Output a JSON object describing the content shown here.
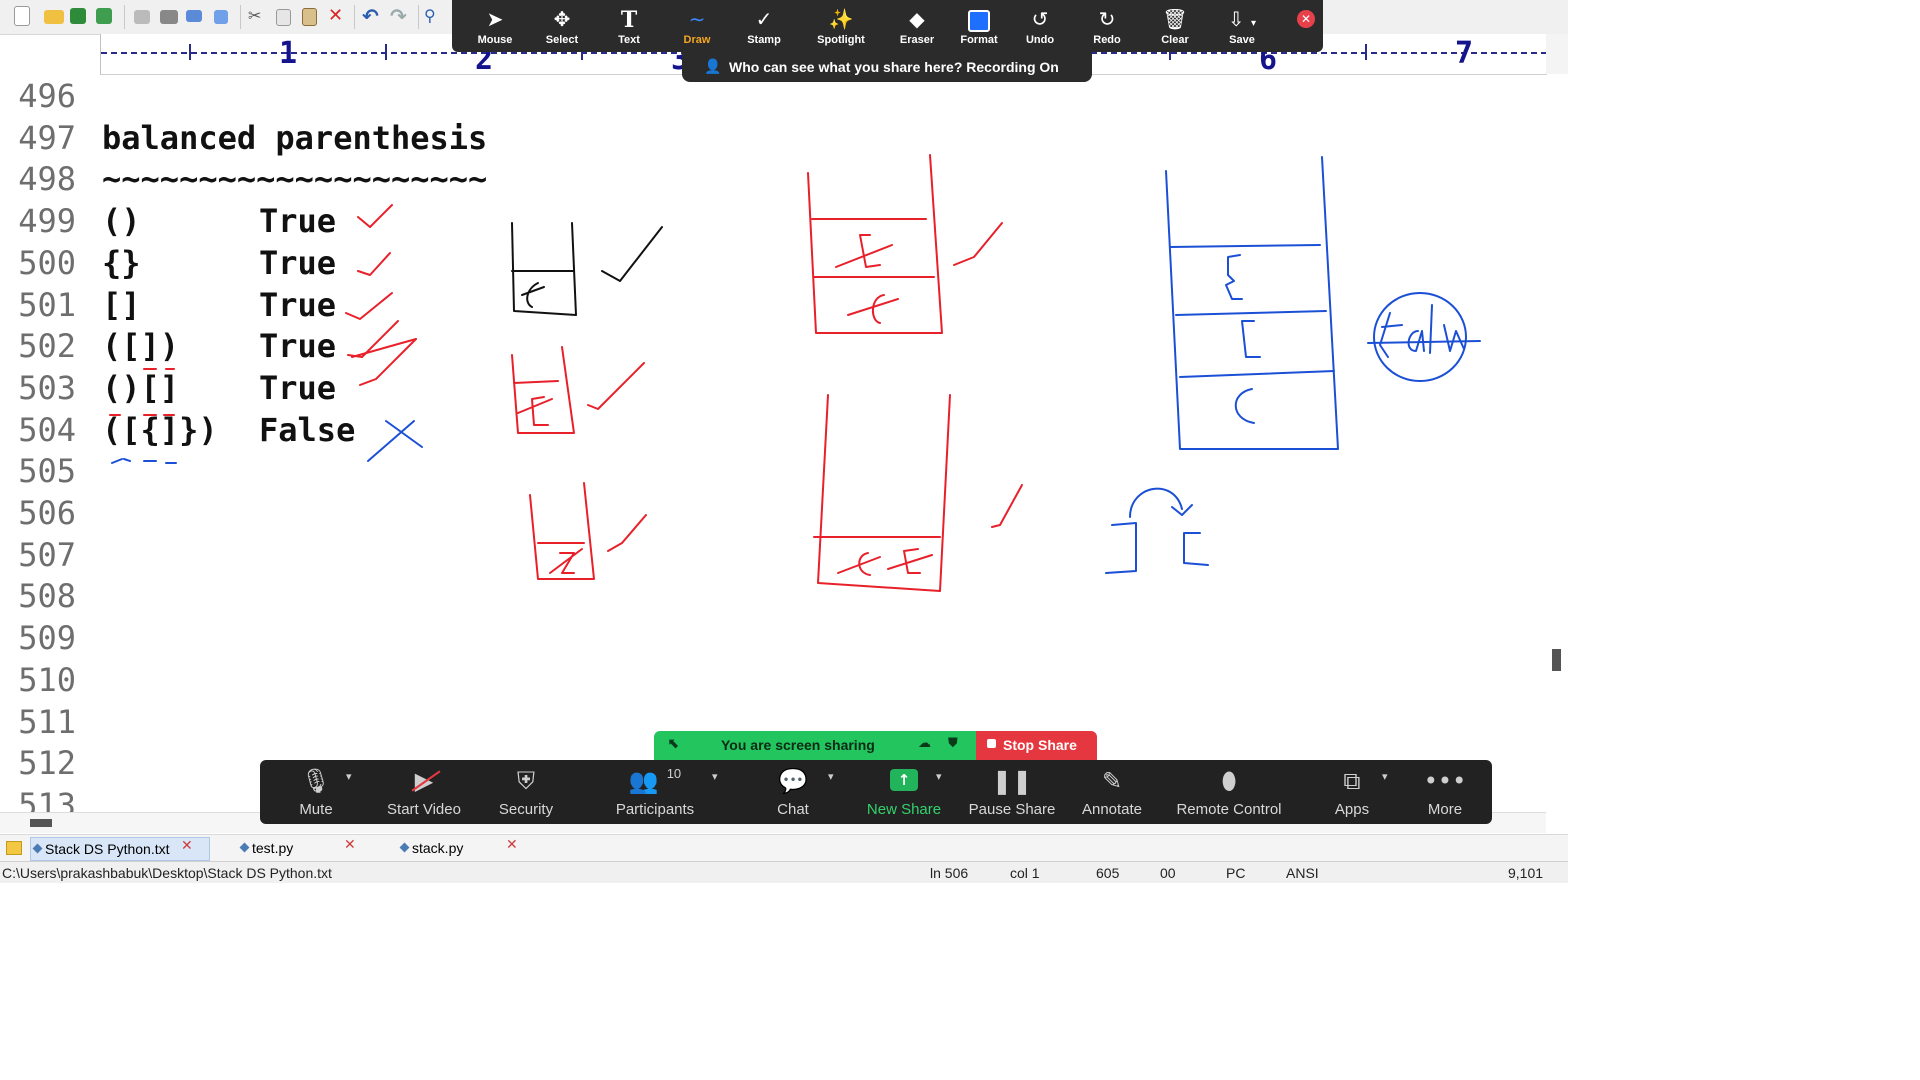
{
  "editor": {
    "ruler_numbers": [
      "1",
      "2",
      "3",
      "6",
      "7"
    ],
    "lines": [
      {
        "num": "496",
        "code": "",
        "result": ""
      },
      {
        "num": "497",
        "code": "balanced parenthesis",
        "result": ""
      },
      {
        "num": "498",
        "code": "~~~~~~~~~~~~~~~~~~~~",
        "result": ""
      },
      {
        "num": "499",
        "code": "()",
        "result": "True"
      },
      {
        "num": "500",
        "code": "{}",
        "result": "True"
      },
      {
        "num": "501",
        "code": "[]",
        "result": "True"
      },
      {
        "num": "502",
        "code": "([])",
        "result": "True"
      },
      {
        "num": "503",
        "code": "()[]",
        "result": "True"
      },
      {
        "num": "504",
        "code": "([{]})",
        "result": "False"
      },
      {
        "num": "505",
        "code": "",
        "result": ""
      },
      {
        "num": "506",
        "code": "",
        "result": ""
      },
      {
        "num": "507",
        "code": "",
        "result": ""
      },
      {
        "num": "508",
        "code": "",
        "result": ""
      },
      {
        "num": "509",
        "code": "",
        "result": ""
      },
      {
        "num": "510",
        "code": "",
        "result": ""
      },
      {
        "num": "511",
        "code": "",
        "result": ""
      },
      {
        "num": "512",
        "code": "",
        "result": ""
      },
      {
        "num": "513",
        "code": "",
        "result": ""
      }
    ],
    "annotation_text": "false"
  },
  "annotation_toolbar": {
    "tools": [
      {
        "label": "Mouse",
        "icon": "mouse-pointer-icon"
      },
      {
        "label": "Select",
        "icon": "move-icon"
      },
      {
        "label": "Text",
        "icon": "text-icon"
      },
      {
        "label": "Draw",
        "icon": "draw-icon"
      },
      {
        "label": "Stamp",
        "icon": "stamp-icon"
      },
      {
        "label": "Spotlight",
        "icon": "spotlight-icon"
      },
      {
        "label": "Eraser",
        "icon": "eraser-icon"
      },
      {
        "label": "Format",
        "icon": "format-icon"
      },
      {
        "label": "Undo",
        "icon": "undo-icon"
      },
      {
        "label": "Redo",
        "icon": "redo-icon"
      },
      {
        "label": "Clear",
        "icon": "trash-icon"
      },
      {
        "label": "Save",
        "icon": "save-icon"
      }
    ],
    "active_tool": "Draw",
    "recording_notice": "Who can see what you share here? Recording On"
  },
  "share_banner": {
    "text": "You are screen sharing",
    "stop_label": "Stop Share"
  },
  "meeting_controls": {
    "items": [
      {
        "label": "Mute",
        "icon": "microphone-icon"
      },
      {
        "label": "Start Video",
        "icon": "video-off-icon"
      },
      {
        "label": "Security",
        "icon": "shield-icon"
      },
      {
        "label": "Participants",
        "icon": "participants-icon",
        "badge": "10"
      },
      {
        "label": "Chat",
        "icon": "chat-icon"
      },
      {
        "label": "New Share",
        "icon": "new-share-icon"
      },
      {
        "label": "Pause Share",
        "icon": "pause-icon"
      },
      {
        "label": "Annotate",
        "icon": "pencil-icon"
      },
      {
        "label": "Remote Control",
        "icon": "mouse-icon"
      },
      {
        "label": "Apps",
        "icon": "apps-icon"
      },
      {
        "label": "More",
        "icon": "more-icon"
      }
    ]
  },
  "tabs": [
    {
      "label": "Stack DS Python.txt",
      "active": true
    },
    {
      "label": "test.py",
      "active": false
    },
    {
      "label": "stack.py",
      "active": false
    }
  ],
  "status": {
    "path": "C:\\Users\\prakashbabuk\\Desktop\\Stack DS Python.txt",
    "line": "ln 506",
    "col": "col 1",
    "sel": "605",
    "val": "00",
    "mode": "PC",
    "encoding": "ANSI",
    "size": "9,101"
  },
  "colors": {
    "ink_red": "#e8202a",
    "ink_blue": "#1a4fd6",
    "accent_draw": "#f5a623",
    "share_green": "#22c55e",
    "stop_red": "#e5373f"
  }
}
